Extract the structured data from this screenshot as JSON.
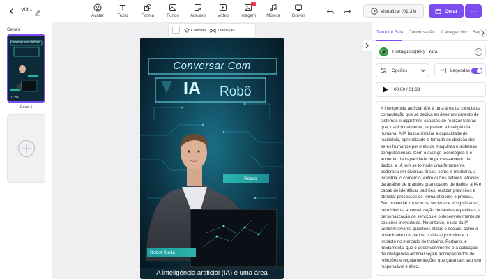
{
  "header": {
    "doc_title": "Víd...",
    "tools": [
      {
        "label": "Avatar",
        "icon": "avatar-icon"
      },
      {
        "label": "Texto",
        "icon": "text-icon"
      },
      {
        "label": "Forma",
        "icon": "shape-icon"
      },
      {
        "label": "Fundo",
        "icon": "background-icon"
      },
      {
        "label": "Adesivo",
        "icon": "sticker-icon"
      },
      {
        "label": "Vídeo",
        "icon": "video-icon"
      },
      {
        "label": "Imagem",
        "icon": "image-icon"
      },
      {
        "label": "Música",
        "icon": "music-icon"
      },
      {
        "label": "Gravar",
        "icon": "record-icon"
      }
    ],
    "preview_label": "Visualizar (01:33)",
    "generate_label": "Gerar",
    "accent_color": "#7b4dee"
  },
  "left_panel": {
    "title": "Cenas",
    "scene": {
      "time": "01:33",
      "name": "Cena 1",
      "thumb_title": "Conversar com IA Robô"
    }
  },
  "canvas_toolbar": {
    "layer_label": "Camada",
    "transition_label": "Transição"
  },
  "video": {
    "title_line1": "Conversar Com",
    "title_ia": "IA",
    "title_robo": "Robô",
    "name_tag_right": "Rocco",
    "name_tag_left": "Robot Stella",
    "caption": "A inteligência artificial (IA) é uma área"
  },
  "right_panel": {
    "tabs": [
      "Texto de Fala",
      "Conversação",
      "Carregar Voz",
      "Sem"
    ],
    "voice": "Portuguese(BR) - Yara",
    "options_label": "Opções",
    "captions_label": "Legendas",
    "captions_enabled": true,
    "time_display": "00:00 / 01:33",
    "script_text": "A inteligência artificial (IA) é uma área da ciência da computação que se dedica ao desenvolvimento de sistemas e algoritmos capazes de realizar tarefas que, tradicionalmente, requerem a inteligência humana. A IA busca simular a capacidade de raciocínio, aprendizado e tomada de decisão dos seres humanos por meio de máquinas e sistemas computacionais. Com o avanço tecnológico e o aumento da capacidade de processamento de dados, a IA tem se tornado uma ferramenta poderosa em diversas áreas, como a medicina, a indústria, o comércio, entre outros setores. Através da análise de grandes quantidades de dados, a IA é capaz de identificar padrões, realizar previsões e otimizar processos de forma eficiente e precisa. Seu potencial impacto na sociedade é significativo, permitindo a automatização de tarefas repetitivas, a personalização de serviços e o desenvolvimento de soluções inovadoras. No entanto, o uso da IA também levanta questões éticas e sociais, como a privacidade dos dados, o viés algorítmico e o impacto no mercado de trabalho. Portanto, é fundamental que o desenvolvimento e a aplicação da inteligência artificial sejam acompanhados de reflexões e regulamentações que garantam seu uso responsável e ético."
  }
}
